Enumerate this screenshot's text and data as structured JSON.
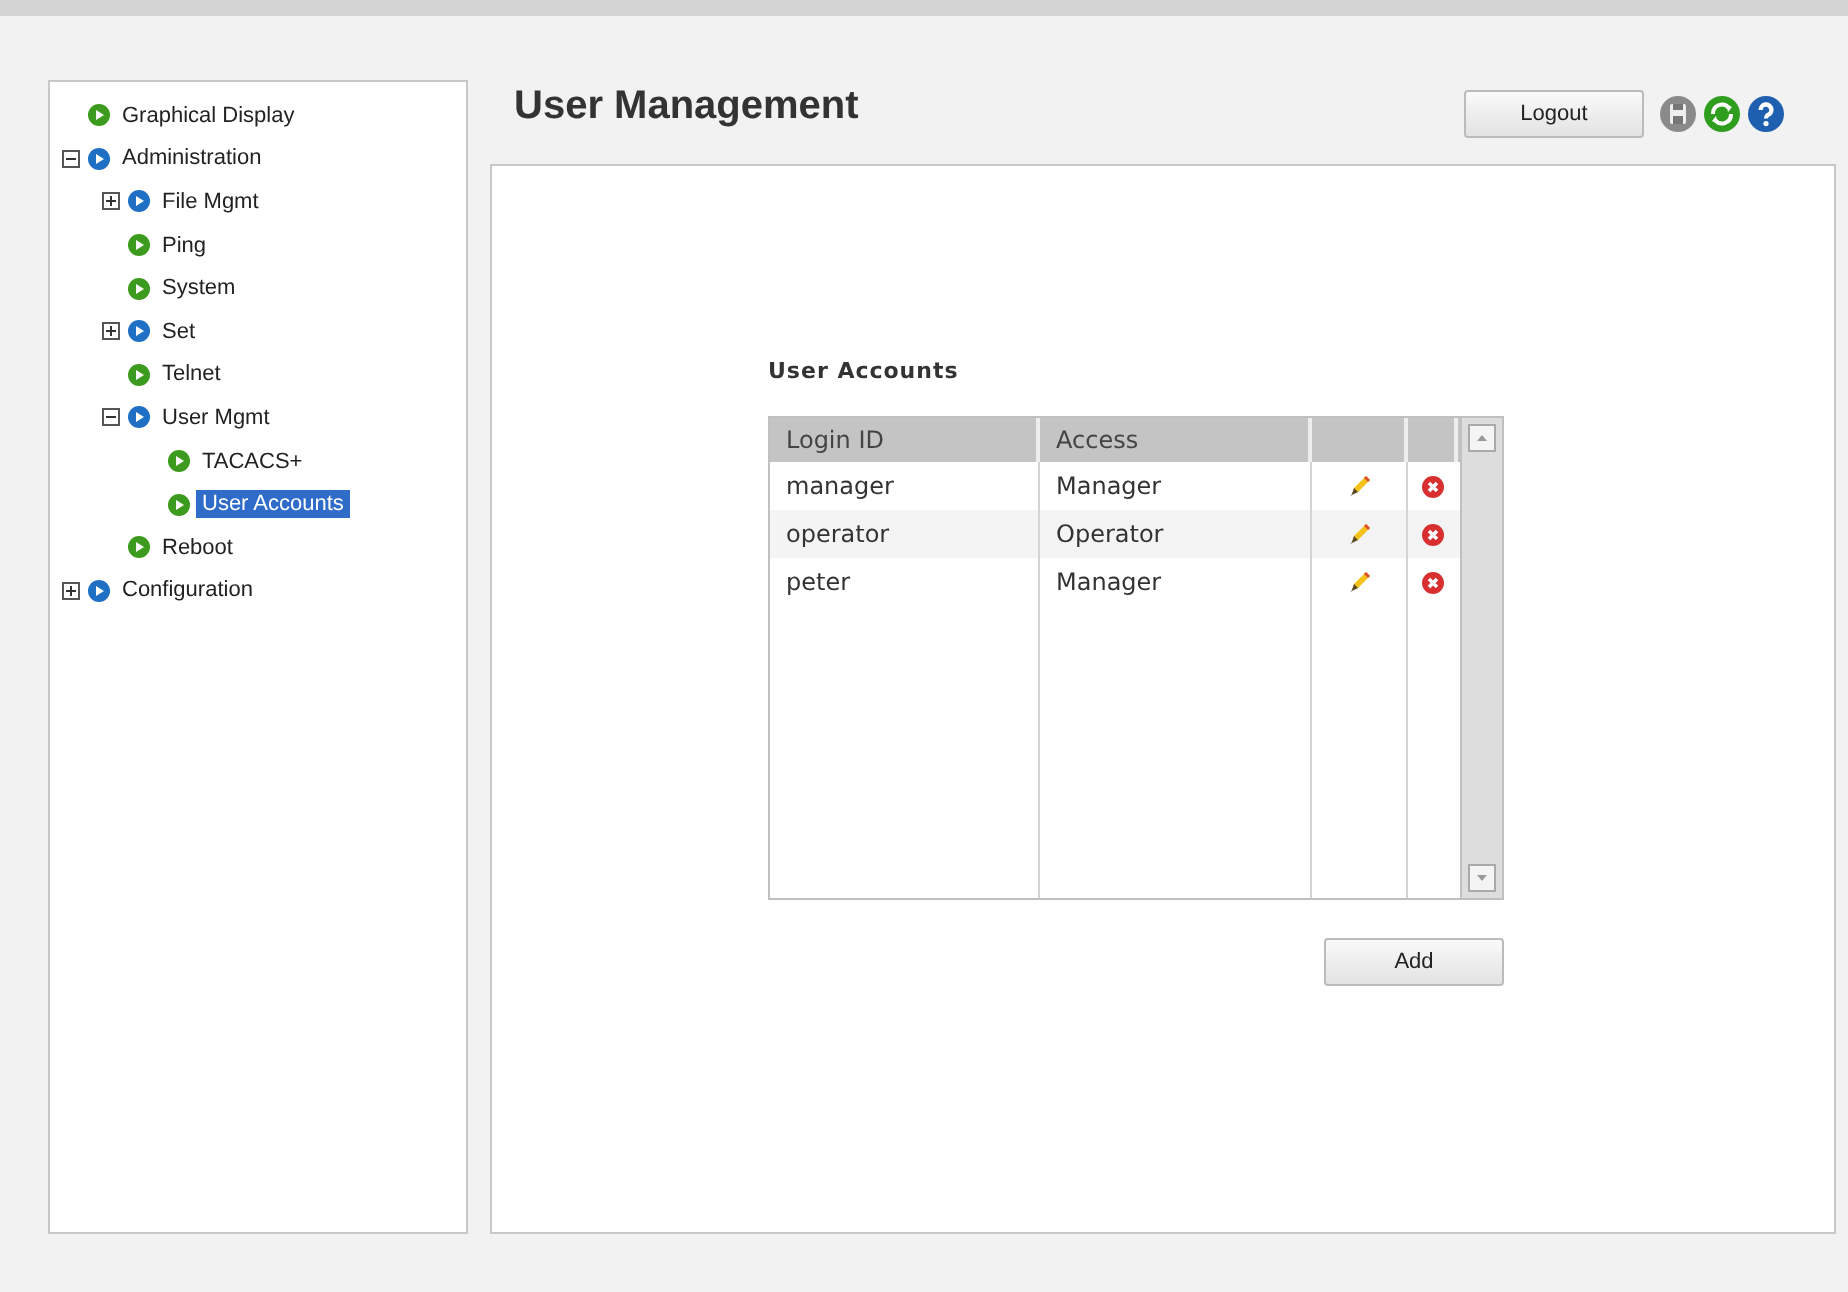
{
  "tree": [
    {
      "label": "Graphical Display",
      "selected": false
    },
    {
      "label": "Administration",
      "expanded": true,
      "selected": false,
      "children": [
        {
          "label": "File Mgmt",
          "expanded": false,
          "selected": false
        },
        {
          "label": "Ping",
          "selected": false
        },
        {
          "label": "System",
          "selected": false
        },
        {
          "label": "Set",
          "expanded": false,
          "selected": false
        },
        {
          "label": "Telnet",
          "selected": false
        },
        {
          "label": "User Mgmt",
          "expanded": true,
          "selected": false,
          "children": [
            {
              "label": "TACACS+",
              "selected": false
            },
            {
              "label": "User Accounts",
              "selected": true
            }
          ]
        },
        {
          "label": "Reboot",
          "selected": false
        }
      ]
    },
    {
      "label": "Configuration",
      "expanded": false,
      "selected": false
    }
  ],
  "page_title": "User Management",
  "logout_button": "Logout",
  "section_title": "User Accounts",
  "table": {
    "columns": [
      "Login ID",
      "Access"
    ],
    "rows": [
      {
        "login_id": "manager",
        "access": "Manager"
      },
      {
        "login_id": "operator",
        "access": "Operator"
      },
      {
        "login_id": "peter",
        "access": "Manager"
      }
    ]
  },
  "add_button": "Add"
}
